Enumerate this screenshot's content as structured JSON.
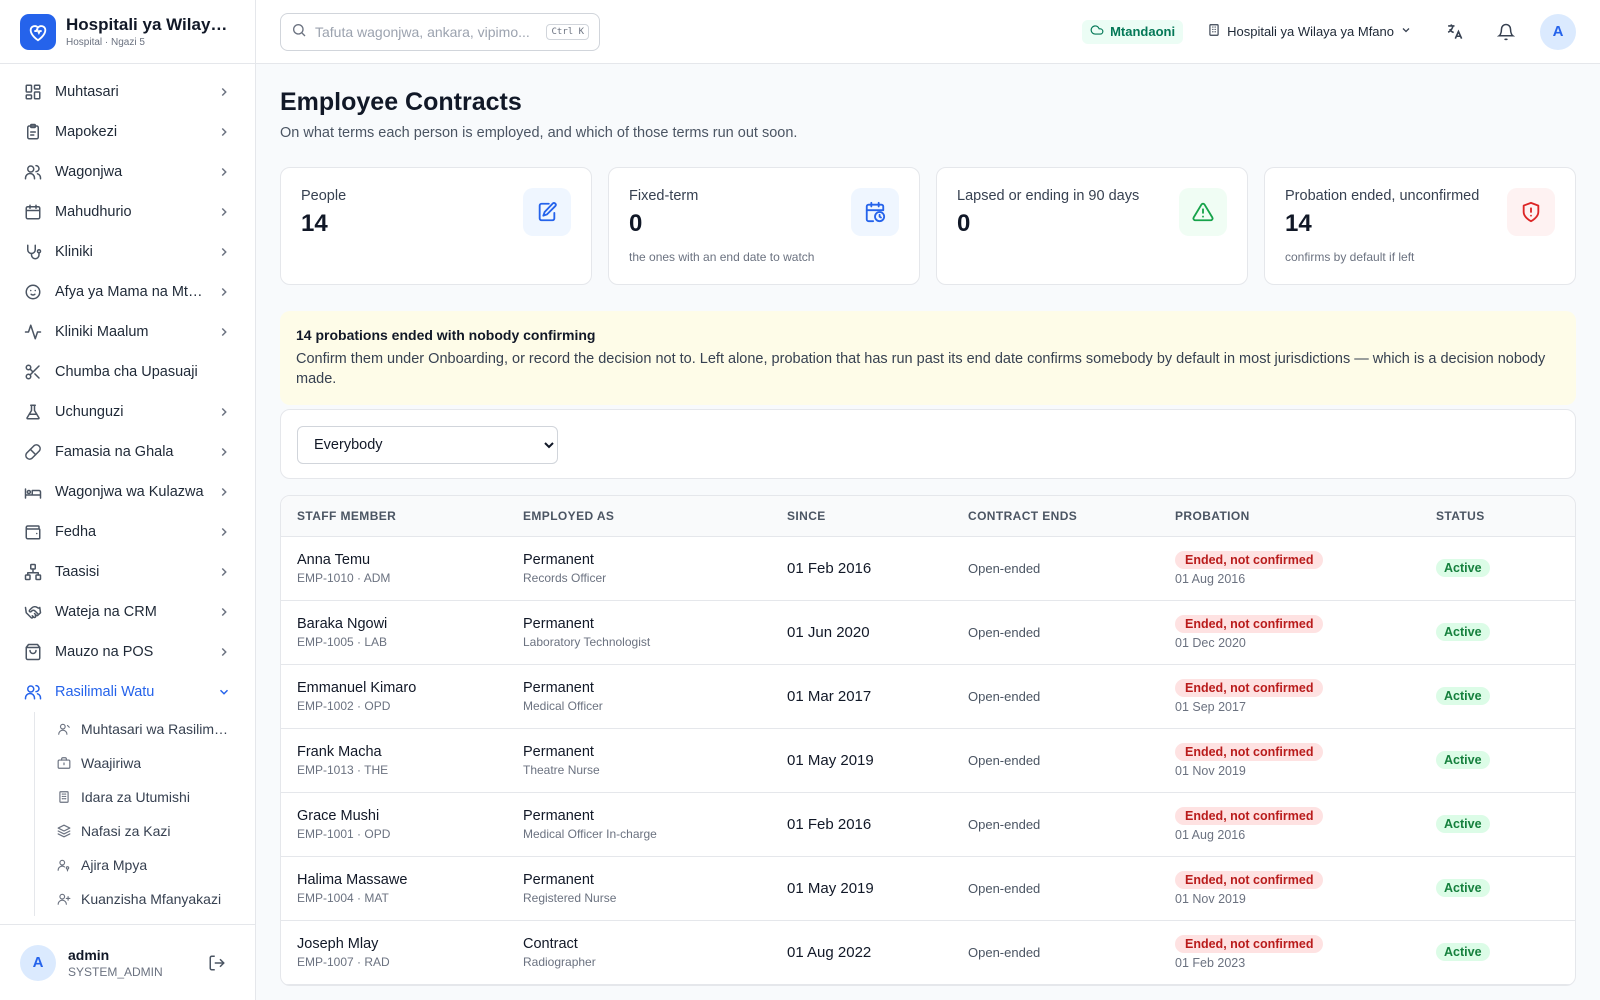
{
  "brand": {
    "name": "Hospitali ya Wilaya ya Mfano",
    "sub": "Hospital · Ngazi 5"
  },
  "nav": [
    {
      "label": "Muhtasari",
      "icon": "dashboard-icon",
      "chevron": true
    },
    {
      "label": "Mapokezi",
      "icon": "clipboard-icon",
      "chevron": true
    },
    {
      "label": "Wagonjwa",
      "icon": "users-icon",
      "chevron": true
    },
    {
      "label": "Mahudhurio",
      "icon": "calendar-icon",
      "chevron": true
    },
    {
      "label": "Kliniki",
      "icon": "stethoscope-icon",
      "chevron": true
    },
    {
      "label": "Afya ya Mama na Mtoto",
      "icon": "baby-icon",
      "chevron": true
    },
    {
      "label": "Kliniki Maalum",
      "icon": "activity-icon",
      "chevron": true
    },
    {
      "label": "Chumba cha Upasuaji",
      "icon": "scissors-icon",
      "chevron": false
    },
    {
      "label": "Uchunguzi",
      "icon": "flask-icon",
      "chevron": true
    },
    {
      "label": "Famasia na Ghala",
      "icon": "pill-icon",
      "chevron": true
    },
    {
      "label": "Wagonjwa wa Kulazwa",
      "icon": "bed-icon",
      "chevron": true
    },
    {
      "label": "Fedha",
      "icon": "wallet-icon",
      "chevron": true
    },
    {
      "label": "Taasisi",
      "icon": "org-icon",
      "chevron": true
    },
    {
      "label": "Wateja na CRM",
      "icon": "handshake-icon",
      "chevron": true
    },
    {
      "label": "Mauzo na POS",
      "icon": "bag-icon",
      "chevron": true
    },
    {
      "label": "Rasilimali Watu",
      "icon": "users-icon",
      "chevron": true,
      "active": true
    }
  ],
  "subnav": [
    {
      "label": "Muhtasari wa Rasilimali Watu",
      "icon": "user-circle-icon"
    },
    {
      "label": "Waajiriwa",
      "icon": "briefcase-icon"
    },
    {
      "label": "Idara za Utumishi",
      "icon": "building-icon"
    },
    {
      "label": "Nafasi za Kazi",
      "icon": "layers-icon"
    },
    {
      "label": "Ajira Mpya",
      "icon": "user-key-icon"
    },
    {
      "label": "Kuanzisha Mfanyakazi",
      "icon": "user-plus-icon"
    }
  ],
  "user": {
    "initial": "A",
    "name": "admin",
    "role": "SYSTEM_ADMIN"
  },
  "topbar": {
    "search_placeholder": "Tafuta wagonjwa, ankara, vipimo...",
    "shortcut": "Ctrl K",
    "online": "Mtandaoni",
    "facility": "Hospitali ya Wilaya ya Mfano",
    "avatar": "A"
  },
  "page": {
    "title": "Employee Contracts",
    "subtitle": "On what terms each person is employed, and which of those terms run out soon."
  },
  "stats": [
    {
      "label": "People",
      "value": "14",
      "note": "",
      "icon": "edit-doc-icon",
      "bg": "#eff6ff",
      "fg": "#2563eb"
    },
    {
      "label": "Fixed-term",
      "value": "0",
      "note": "the ones with an end date to watch",
      "icon": "calendar-clock-icon",
      "bg": "#eff6ff",
      "fg": "#2563eb"
    },
    {
      "label": "Lapsed or ending in 90 days",
      "value": "0",
      "note": "",
      "icon": "warning-icon",
      "bg": "#f0fdf4",
      "fg": "#16a34a"
    },
    {
      "label": "Probation ended, unconfirmed",
      "value": "14",
      "note": "confirms by default if left",
      "icon": "shield-alert-icon",
      "bg": "#fef2f2",
      "fg": "#dc2626"
    }
  ],
  "alert": {
    "title": "14 probations ended with nobody confirming",
    "body": "Confirm them under Onboarding, or record the decision not to. Left alone, probation that has run past its end date confirms somebody by default in most jurisdictions — which is a decision nobody made."
  },
  "filter": {
    "selected": "Everybody"
  },
  "table": {
    "headers": [
      "STAFF MEMBER",
      "EMPLOYED AS",
      "SINCE",
      "CONTRACT ENDS",
      "PROBATION",
      "STATUS"
    ],
    "rows": [
      {
        "name": "Anna Temu",
        "code": "EMP-1010 · ADM",
        "type": "Permanent",
        "role": "Records Officer",
        "since": "01 Feb 2016",
        "ends": "Open-ended",
        "probation": "Ended, not confirmed",
        "prob_date": "01 Aug 2016",
        "status": "Active"
      },
      {
        "name": "Baraka Ngowi",
        "code": "EMP-1005 · LAB",
        "type": "Permanent",
        "role": "Laboratory Technologist",
        "since": "01 Jun 2020",
        "ends": "Open-ended",
        "probation": "Ended, not confirmed",
        "prob_date": "01 Dec 2020",
        "status": "Active"
      },
      {
        "name": "Emmanuel Kimaro",
        "code": "EMP-1002 · OPD",
        "type": "Permanent",
        "role": "Medical Officer",
        "since": "01 Mar 2017",
        "ends": "Open-ended",
        "probation": "Ended, not confirmed",
        "prob_date": "01 Sep 2017",
        "status": "Active"
      },
      {
        "name": "Frank Macha",
        "code": "EMP-1013 · THE",
        "type": "Permanent",
        "role": "Theatre Nurse",
        "since": "01 May 2019",
        "ends": "Open-ended",
        "probation": "Ended, not confirmed",
        "prob_date": "01 Nov 2019",
        "status": "Active"
      },
      {
        "name": "Grace Mushi",
        "code": "EMP-1001 · OPD",
        "type": "Permanent",
        "role": "Medical Officer In-charge",
        "since": "01 Feb 2016",
        "ends": "Open-ended",
        "probation": "Ended, not confirmed",
        "prob_date": "01 Aug 2016",
        "status": "Active"
      },
      {
        "name": "Halima Massawe",
        "code": "EMP-1004 · MAT",
        "type": "Permanent",
        "role": "Registered Nurse",
        "since": "01 May 2019",
        "ends": "Open-ended",
        "probation": "Ended, not confirmed",
        "prob_date": "01 Nov 2019",
        "status": "Active"
      },
      {
        "name": "Joseph Mlay",
        "code": "EMP-1007 · RAD",
        "type": "Contract",
        "role": "Radiographer",
        "since": "01 Aug 2022",
        "ends": "Open-ended",
        "probation": "Ended, not confirmed",
        "prob_date": "01 Feb 2023",
        "status": "Active"
      }
    ]
  }
}
